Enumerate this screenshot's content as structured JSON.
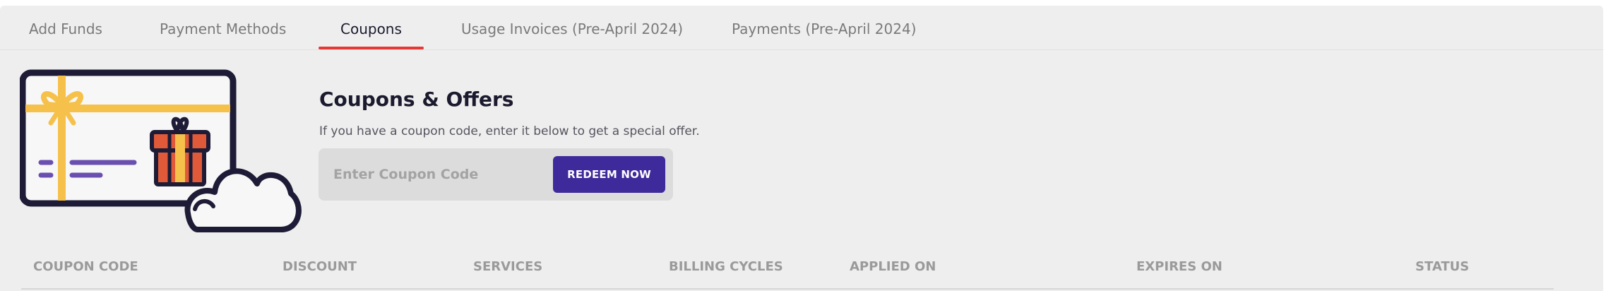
{
  "tabs": [
    {
      "label": "Add Funds"
    },
    {
      "label": "Payment Methods"
    },
    {
      "label": "Coupons"
    },
    {
      "label": "Usage Invoices (Pre-April 2024)"
    },
    {
      "label": "Payments (Pre-April 2024)"
    }
  ],
  "active_tab": "Coupons",
  "heading": {
    "title": "Coupons & Offers",
    "subtitle": "If you have a coupon code, enter it below to get a special offer."
  },
  "coupon_form": {
    "input_value": "",
    "placeholder": "Enter Coupon Code",
    "button_label": "REDEEM NOW"
  },
  "table": {
    "columns": [
      "COUPON CODE",
      "DISCOUNT",
      "SERVICES",
      "BILLING CYCLES",
      "APPLIED ON",
      "EXPIRES ON",
      "STATUS"
    ],
    "rows": []
  },
  "colors": {
    "accent_underline": "#e53935",
    "button": "#3f2a9b",
    "illustration_outline": "#1d1b36",
    "ribbon": "#f6c14b",
    "gift_red": "#e05a3a",
    "lines_purple": "#6a4fb0"
  },
  "icons": {
    "illustration": "gift-card-cloud-illustration"
  }
}
